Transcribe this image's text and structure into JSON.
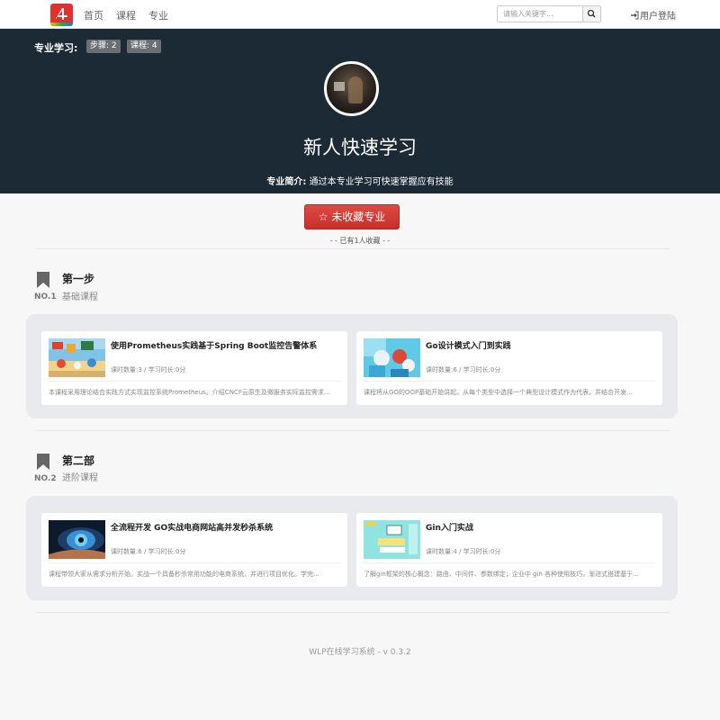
{
  "nav": {
    "links": [
      "首页",
      "课程",
      "专业"
    ],
    "search_placeholder": "请输入关键字...",
    "login": "用户登陆",
    "logo_icon": "app-logo"
  },
  "hero": {
    "label": "专业学习:",
    "tags": [
      "步骤: 2",
      "课程: 4"
    ],
    "title": "新人快速学习",
    "intro_label": "专业简介:",
    "intro_text": "通过本专业学习可快速掌握应有技能"
  },
  "favorite": {
    "button": "☆ 未收藏专业",
    "count": "- - 已有1人收藏 - -"
  },
  "steps": [
    {
      "no": "NO.1",
      "title": "第一步",
      "subtitle": "基础课程",
      "courses": [
        {
          "title": "使用Prometheus实践基于Spring Boot监控告警体系",
          "meta": "课时数量:3 / 学习时长:0分",
          "desc": "本课程采用理论结合实践方式实现监控系统Prometheus。介绍CNCF云原生及微服务实际监控需求..."
        },
        {
          "title": "Go设计模式入门到实践",
          "meta": "课时数量:6 / 学习时长:0分",
          "desc": "课程将从GO的OOP基础开始讲起。从每个类型中选择一个典型设计模式作为代表，并结合开发..."
        }
      ]
    },
    {
      "no": "NO.2",
      "title": "第二部",
      "subtitle": "进阶课程",
      "courses": [
        {
          "title": "全流程开发 GO实战电商网站高并发秒杀系统",
          "meta": "课时数量:6 / 学习时长:0分",
          "desc": "课程带领大家从需求分析开始。实战一个具备秒杀常用功能的电商系统，并进行项目优化。学完..."
        },
        {
          "title": "Gin入门实战",
          "meta": "课时数量:4 / 学习时长:0分",
          "desc": "了解gin框架的核心概念：路由、中间件、参数绑定；企业中 gin 各种使用技巧，渐进式搭建基于..."
        }
      ]
    }
  ],
  "footer": {
    "text": "WLP在线学习系统 - v 0.3.2"
  },
  "colors": {
    "hero_bg": "#1b2a35",
    "accent_red": "#d43f3a",
    "panel_bg": "#e9eaed"
  }
}
